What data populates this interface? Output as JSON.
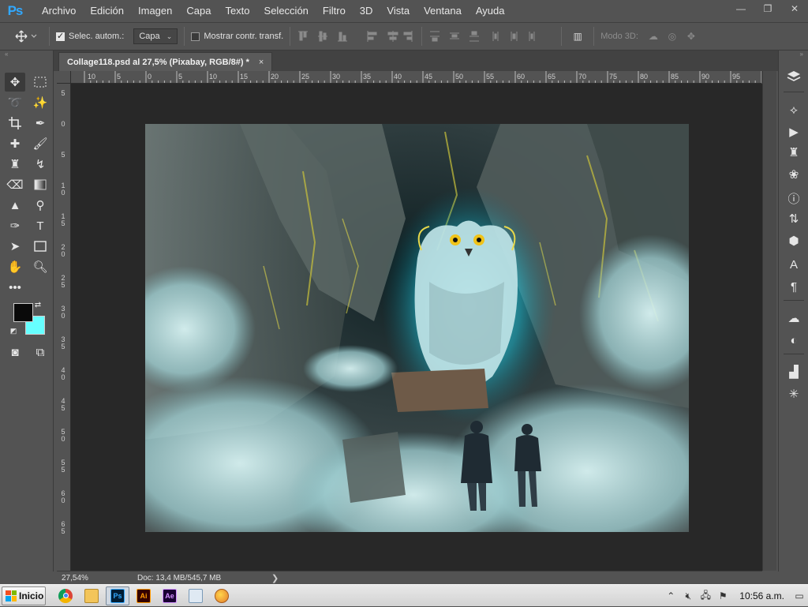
{
  "app": {
    "logo_text": "Ps",
    "menu": [
      "Archivo",
      "Edición",
      "Imagen",
      "Capa",
      "Texto",
      "Selección",
      "Filtro",
      "3D",
      "Vista",
      "Ventana",
      "Ayuda"
    ],
    "window_controls": {
      "minimize": "—",
      "restore": "❐",
      "close": "✕"
    }
  },
  "options_bar": {
    "auto_select_label": "Selec. autom.:",
    "auto_select_checked": true,
    "auto_select_target": "Capa",
    "show_transform_label": "Mostrar contr. transf.",
    "show_transform_checked": false,
    "mode_3d_label": "Modo 3D:"
  },
  "document": {
    "tab_title": "Collage118.psd al 27,5% (Pixabay, RGB/8#) *",
    "tab_close": "×"
  },
  "rulers": {
    "top": [
      "10",
      "5",
      "0",
      "5",
      "10",
      "15",
      "20",
      "25",
      "30",
      "35",
      "40",
      "45",
      "50",
      "55",
      "60",
      "65",
      "70",
      "75",
      "80",
      "85",
      "90",
      "95"
    ],
    "left": [
      "5",
      "0",
      "5",
      "1\n0",
      "1\n5",
      "2\n0",
      "2\n5",
      "3\n0",
      "3\n5",
      "4\n0",
      "4\n5",
      "5\n0",
      "5\n5",
      "6\n0",
      "6\n5"
    ]
  },
  "status": {
    "zoom": "27,54%",
    "doc_info": "Doc: 13,4 MB/545,7 MB",
    "arrow": "❯"
  },
  "colors": {
    "foreground": "#0a0a0a",
    "background": "#66ffff",
    "ui_panel": "#535353",
    "pasteboard": "#282828"
  },
  "taskbar": {
    "start_label": "Inicio",
    "apps": [
      "chrome",
      "file-explorer",
      "photoshop",
      "illustrator",
      "after-effects",
      "notepad",
      "paint"
    ],
    "app_labels": {
      "photoshop": "Ps",
      "illustrator": "Ai",
      "after-effects": "Ae"
    },
    "clock": "10:56 a.m."
  }
}
